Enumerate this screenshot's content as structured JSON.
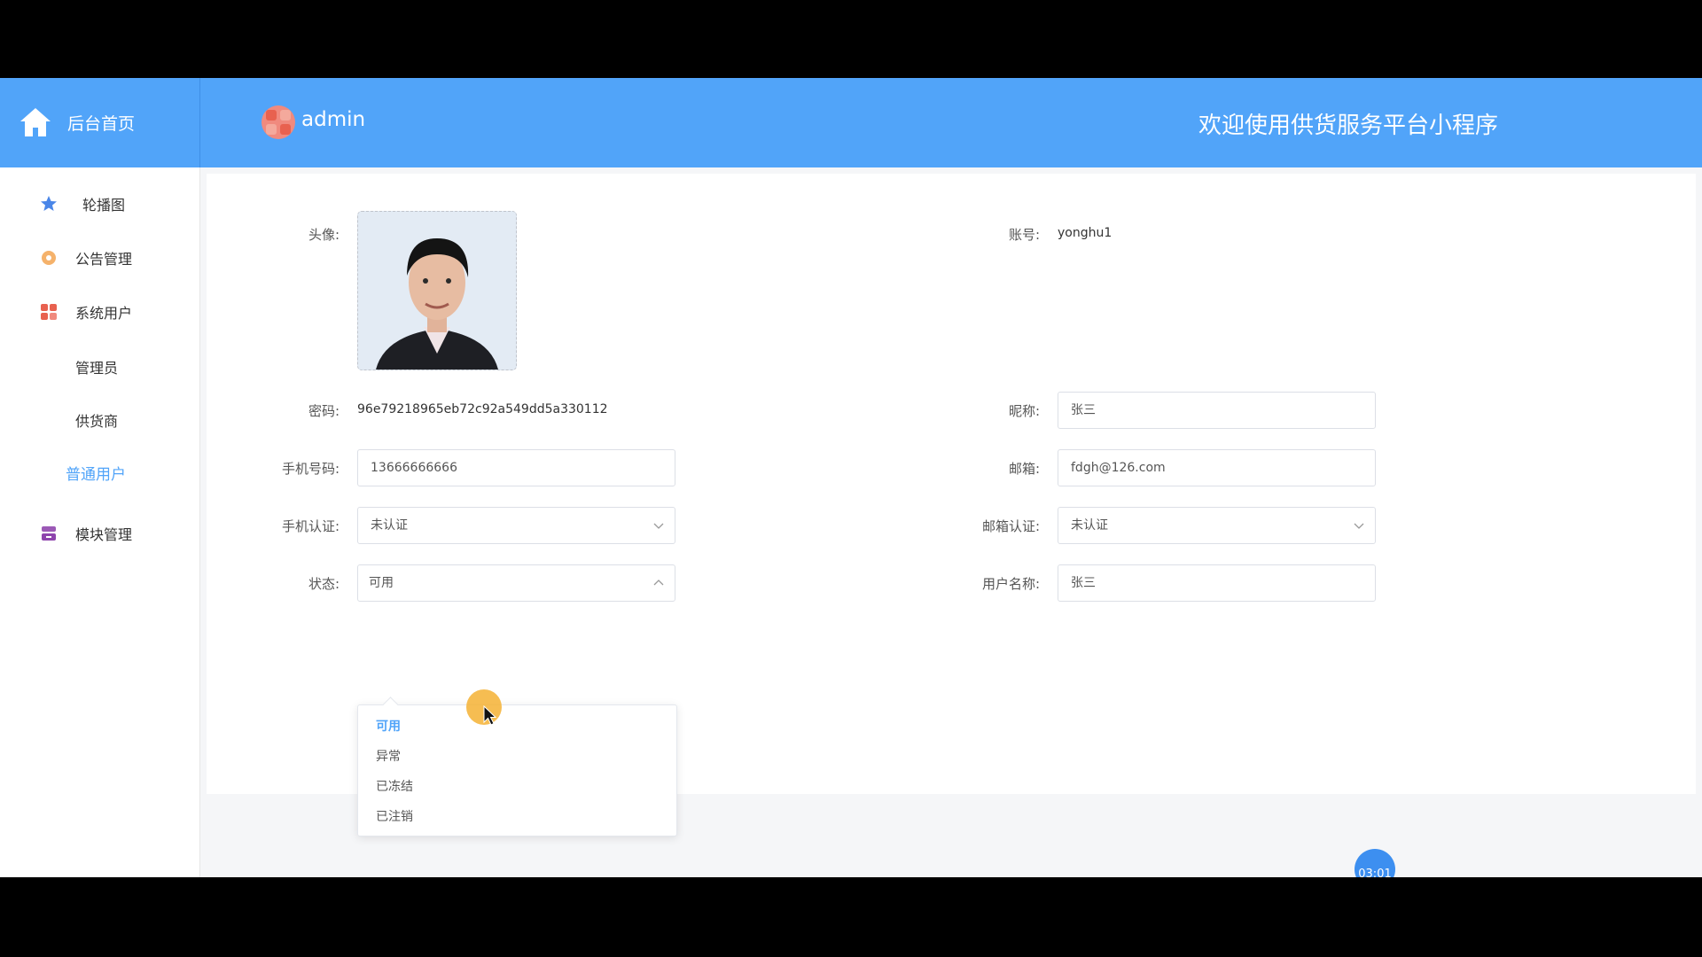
{
  "header": {
    "home_label": "后台首页",
    "user_name": "admin",
    "welcome_text": "欢迎使用供货服务平台小程序",
    "bg_color": "#51a4f9"
  },
  "sidebar": {
    "items": [
      {
        "label": "轮播图",
        "icon": "star-icon"
      },
      {
        "label": "公告管理",
        "icon": "gear-icon"
      },
      {
        "label": "系统用户",
        "icon": "grid-icon"
      },
      {
        "label": "管理员"
      },
      {
        "label": "供货商"
      },
      {
        "label": "普通用户",
        "active": true
      },
      {
        "label": "模块管理",
        "icon": "archive-icon"
      }
    ]
  },
  "form": {
    "avatar_label": "头像:",
    "account_label": "账号:",
    "account_value": "yonghu1",
    "password_label": "密码:",
    "password_value": "96e79218965eb72c92a549dd5a330112",
    "nickname_label": "昵称:",
    "nickname_value": "张三",
    "phone_label": "手机号码:",
    "phone_value": "13666666666",
    "email_label": "邮箱:",
    "email_value": "fdgh@126.com",
    "phone_verify_label": "手机认证:",
    "phone_verify_value": "未认证",
    "email_verify_label": "邮箱认证:",
    "email_verify_value": "未认证",
    "status_label": "状态:",
    "status_value": "可用",
    "username_label": "用户名称:",
    "username_value": "张三"
  },
  "status_options": [
    "可用",
    "异常",
    "已冻结",
    "已注销"
  ],
  "timer": "03:01"
}
